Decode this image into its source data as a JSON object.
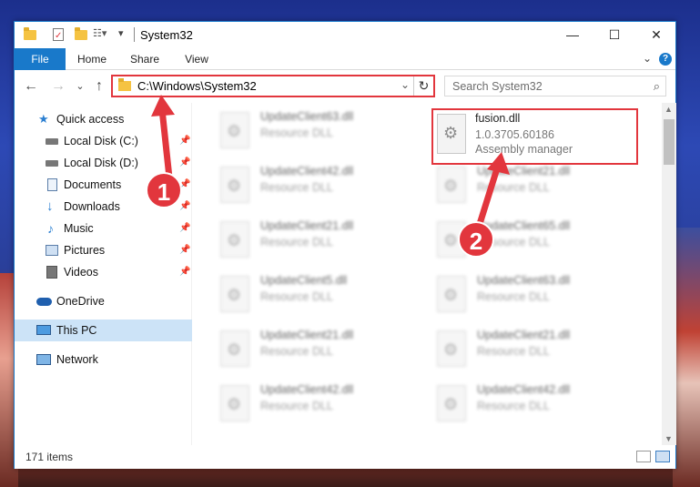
{
  "window": {
    "title": "System32",
    "controls": {
      "minimize": "—",
      "maximize": "☐",
      "close": "✕"
    }
  },
  "ribbon": {
    "tabs": [
      "File",
      "Home",
      "Share",
      "View"
    ],
    "expand": "⌄",
    "help": "?"
  },
  "nav": {
    "back": "←",
    "forward": "→",
    "recent": "⌄",
    "up": "↑",
    "address": "C:\\Windows\\System32",
    "dropdown": "⌄",
    "refresh": "↻",
    "search_placeholder": "Search System32",
    "search_icon": "⌕"
  },
  "sidebar": {
    "items": [
      {
        "label": "Quick access",
        "icon": "star-icon",
        "pinned": false
      },
      {
        "label": "Local Disk (C:)",
        "icon": "drive-icon",
        "pinned": true
      },
      {
        "label": "Local Disk (D:)",
        "icon": "drive-icon",
        "pinned": true
      },
      {
        "label": "Documents",
        "icon": "document-icon",
        "pinned": true
      },
      {
        "label": "Downloads",
        "icon": "download-icon",
        "pinned": true
      },
      {
        "label": "Music",
        "icon": "music-icon",
        "pinned": true
      },
      {
        "label": "Pictures",
        "icon": "pictures-icon",
        "pinned": true
      },
      {
        "label": "Videos",
        "icon": "videos-icon",
        "pinned": true
      },
      {
        "label": "OneDrive",
        "icon": "cloud-icon",
        "pinned": false
      },
      {
        "label": "This PC",
        "icon": "computer-icon",
        "pinned": false,
        "selected": true
      },
      {
        "label": "Network",
        "icon": "network-icon",
        "pinned": false
      }
    ],
    "pin_glyph": "📌"
  },
  "files": {
    "left": [
      {
        "name": "UpdateClient63.dll",
        "type": "Resource DLL"
      },
      {
        "name": "UpdateClient42.dll",
        "type": "Resource DLL"
      },
      {
        "name": "UpdateClient21.dll",
        "type": "Resource DLL"
      },
      {
        "name": "UpdateClient5.dll",
        "type": "Resource DLL"
      },
      {
        "name": "UpdateClient21.dll",
        "type": "Resource DLL"
      },
      {
        "name": "UpdateClient42.dll",
        "type": "Resource DLL"
      }
    ],
    "right": [
      {
        "name": "UpdateClient21.dll",
        "type": "Resource DLL"
      },
      {
        "name": "UpdateClient65.dll",
        "type": "Resource DLL"
      },
      {
        "name": "UpdateClient63.dll",
        "type": "Resource DLL"
      },
      {
        "name": "UpdateClient21.dll",
        "type": "Resource DLL"
      },
      {
        "name": "UpdateClient42.dll",
        "type": "Resource DLL"
      }
    ],
    "highlighted": {
      "name": "fusion.dll",
      "version": "1.0.3705.60186",
      "description": "Assembly manager"
    }
  },
  "status": {
    "count": "171 items"
  },
  "annotations": {
    "step1": "1",
    "step2": "2",
    "color": "#e2363d"
  }
}
